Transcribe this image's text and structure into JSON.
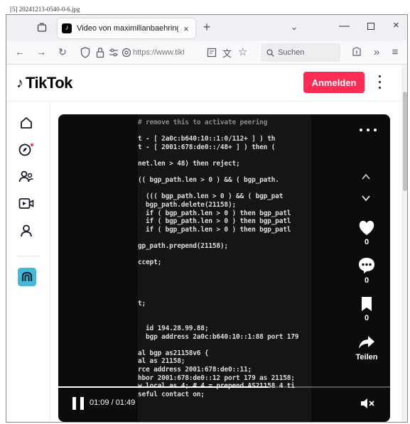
{
  "filename": "[5] 20241213-0540-0-6.jpg",
  "browser": {
    "tab_title": "Video von maximilianbaehring",
    "tab_favicon": "♪",
    "tab_close": "×",
    "new_tab": "+",
    "tabs_dropdown": "⌄",
    "window_minimize": "—",
    "window_close": "×",
    "url": "https://www.tiktok.com",
    "search_placeholder": "Suchen"
  },
  "tiktok": {
    "logo_mark": "♪",
    "logo_text": "TikTok",
    "login_label": "Anmelden"
  },
  "sidebar": {
    "items": [
      {
        "name": "home-icon"
      },
      {
        "name": "explore-icon"
      },
      {
        "name": "following-icon"
      },
      {
        "name": "live-icon"
      },
      {
        "name": "profile-icon"
      }
    ]
  },
  "video": {
    "code_lines": [
      "# remove this to activate peering",
      "",
      "t - [ 2a0c:b640:10::1:0/112+ ] ) th",
      "t - [ 2001:678:de0::/48+ ] ) then (",
      "",
      "net.len > 48) then reject;",
      "",
      "(( bgp_path.len > 0 ) && ( bgp_path.",
      "",
      "  ((( bgp_path.len > 0 ) && ( bgp_pat",
      "  bgp_path.delete(21158);",
      "  if ( bgp_path.len > 0 ) then bgp_patl",
      "  if ( bgp_path.len > 0 ) then bgp_patl",
      "  if ( bgp_path.len > 0 ) then bgp_patl",
      "",
      "gp_path.prepend(21158);",
      "",
      "ccept;",
      "",
      "",
      "",
      "",
      "t;",
      "",
      "",
      "  id 194.28.99.88;",
      "  bgp address 2a0c:b640:10::1:88 port 179",
      "",
      "al bgp as21158v6 {",
      "al as 21158;",
      "rce address 2001:678:de0::11;",
      "hbor 2001:678:de0::12 port 179 as 21158;",
      "w local as 4; # 4 = prepend AS21158 4 ti",
      "seful contact on;"
    ],
    "likes": "0",
    "comments": "0",
    "saves": "0",
    "share_label": "Teilen",
    "time": "01:09 / 01:49",
    "progress_fraction": 0.633
  }
}
